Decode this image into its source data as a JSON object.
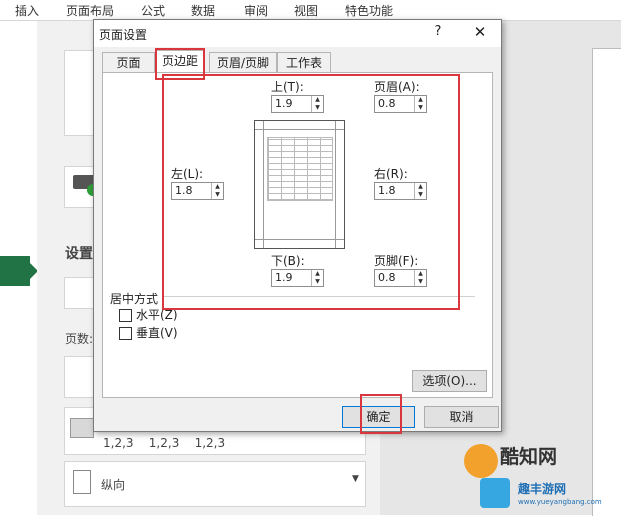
{
  "ribbon": {
    "tabs": [
      "插入",
      "页面布局",
      "公式",
      "数据",
      "审阅",
      "视图",
      "特色功能"
    ]
  },
  "background": {
    "section_heading": "设置",
    "pages_label": "页数:",
    "collate_text": "1,2,3    1,2,3    1,2,3",
    "orientation_label": "纵向"
  },
  "dialog": {
    "title": "页面设置",
    "help": "?",
    "close": "✕",
    "tabs": [
      "页面",
      "页边距",
      "页眉/页脚",
      "工作表"
    ],
    "active_tab": 1,
    "margins": {
      "top": {
        "label": "上(T):",
        "value": "1.9"
      },
      "header": {
        "label": "页眉(A):",
        "value": "0.8"
      },
      "left": {
        "label": "左(L):",
        "value": "1.8"
      },
      "right": {
        "label": "右(R):",
        "value": "1.8"
      },
      "bottom": {
        "label": "下(B):",
        "value": "1.9"
      },
      "footer": {
        "label": "页脚(F):",
        "value": "0.8"
      }
    },
    "center": {
      "title": "居中方式",
      "horizontal": "水平(Z)",
      "vertical": "垂直(V)",
      "horizontal_checked": false,
      "vertical_checked": false
    },
    "options_button": "选项(O)...",
    "ok_button": "确定",
    "cancel_button": "取消"
  },
  "watermark": {
    "main": "酷知网",
    "sub": "趣丰游网",
    "url": "www.yueyangbang.com"
  },
  "colors": {
    "accent": "#217346",
    "highlight": "#d9363e",
    "primary_border": "#0078d7"
  }
}
